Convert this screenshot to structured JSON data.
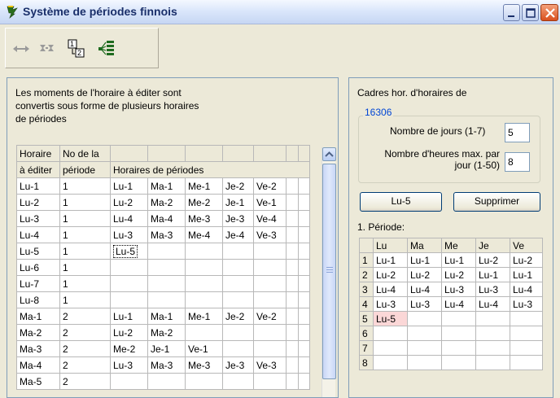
{
  "window": {
    "title": "Système de périodes finnois"
  },
  "toolbar": {
    "buttons": [
      {
        "name": "arrows",
        "icon": "double-arrow-icon"
      },
      {
        "name": "hourglass",
        "icon": "hourglass-icon"
      },
      {
        "name": "numbers",
        "icon": "number-boxes-icon"
      },
      {
        "name": "tree",
        "icon": "tree-list-icon"
      }
    ]
  },
  "left": {
    "desc_line1": "Les moments de l'horaire à éditer sont",
    "desc_line2": "convertis sous forme de plusieurs horaires",
    "desc_line3": "de périodes",
    "hdr_col1_a": "Horaire",
    "hdr_col1_b": "à éditer",
    "hdr_col2_a": "No de la",
    "hdr_col2_b": "période",
    "hdr_periods": "Horaires de périodes",
    "rows": [
      {
        "a": "Lu-1",
        "p": "1",
        "c": [
          "Lu-1",
          "Ma-1",
          "Me-1",
          "Je-2",
          "Ve-2"
        ]
      },
      {
        "a": "Lu-2",
        "p": "1",
        "c": [
          "Lu-2",
          "Ma-2",
          "Me-2",
          "Je-1",
          "Ve-1"
        ]
      },
      {
        "a": "Lu-3",
        "p": "1",
        "c": [
          "Lu-4",
          "Ma-4",
          "Me-3",
          "Je-3",
          "Ve-4"
        ]
      },
      {
        "a": "Lu-4",
        "p": "1",
        "c": [
          "Lu-3",
          "Ma-3",
          "Me-4",
          "Je-4",
          "Ve-3"
        ]
      },
      {
        "a": "Lu-5",
        "p": "1",
        "c": [
          "Lu-5",
          "",
          "",
          "",
          ""
        ]
      },
      {
        "a": "Lu-6",
        "p": "1",
        "c": [
          "",
          "",
          "",
          "",
          ""
        ]
      },
      {
        "a": "Lu-7",
        "p": "1",
        "c": [
          "",
          "",
          "",
          "",
          ""
        ]
      },
      {
        "a": "Lu-8",
        "p": "1",
        "c": [
          "",
          "",
          "",
          "",
          ""
        ]
      },
      {
        "a": "Ma-1",
        "p": "2",
        "c": [
          "Lu-1",
          "Ma-1",
          "Me-1",
          "Je-2",
          "Ve-2"
        ]
      },
      {
        "a": "Ma-2",
        "p": "2",
        "c": [
          "Lu-2",
          "Ma-2",
          "",
          "",
          ""
        ]
      },
      {
        "a": "Ma-3",
        "p": "2",
        "c": [
          "Me-2",
          "Je-1",
          "Ve-1",
          "",
          ""
        ]
      },
      {
        "a": "Ma-4",
        "p": "2",
        "c": [
          "Lu-3",
          "Ma-3",
          "Me-3",
          "Je-3",
          "Ve-3"
        ]
      },
      {
        "a": "Ma-5",
        "p": "2",
        "c": [
          "",
          "",
          "",
          "",
          ""
        ]
      }
    ]
  },
  "right": {
    "caption": "Cadres hor. d'horaires de",
    "legend": "16306",
    "days_label": "Nombre de jours (1-7)",
    "days_value": "5",
    "hours_label": "Nombre d'heures max. par jour (1-50)",
    "hours_value": "8",
    "btn_lu5": "Lu-5",
    "btn_delete": "Supprimer",
    "period_label": "1. Période:",
    "grid_headers": [
      "",
      "Lu",
      "Ma",
      "Me",
      "Je",
      "Ve"
    ],
    "grid_rows": [
      {
        "n": "1",
        "c": [
          "Lu-1",
          "Lu-1",
          "Lu-1",
          "Lu-2",
          "Lu-2"
        ]
      },
      {
        "n": "2",
        "c": [
          "Lu-2",
          "Lu-2",
          "Lu-2",
          "Lu-1",
          "Lu-1"
        ]
      },
      {
        "n": "3",
        "c": [
          "Lu-4",
          "Lu-4",
          "Lu-3",
          "Lu-3",
          "Lu-4"
        ]
      },
      {
        "n": "4",
        "c": [
          "Lu-3",
          "Lu-3",
          "Lu-4",
          "Lu-4",
          "Lu-3"
        ]
      },
      {
        "n": "5",
        "c": [
          "Lu-5",
          "",
          "",
          "",
          ""
        ]
      },
      {
        "n": "6",
        "c": [
          "",
          "",
          "",
          "",
          ""
        ]
      },
      {
        "n": "7",
        "c": [
          "",
          "",
          "",
          "",
          ""
        ]
      },
      {
        "n": "8",
        "c": [
          "",
          "",
          "",
          "",
          ""
        ]
      }
    ],
    "highlight_color": "#fbd7d7"
  }
}
